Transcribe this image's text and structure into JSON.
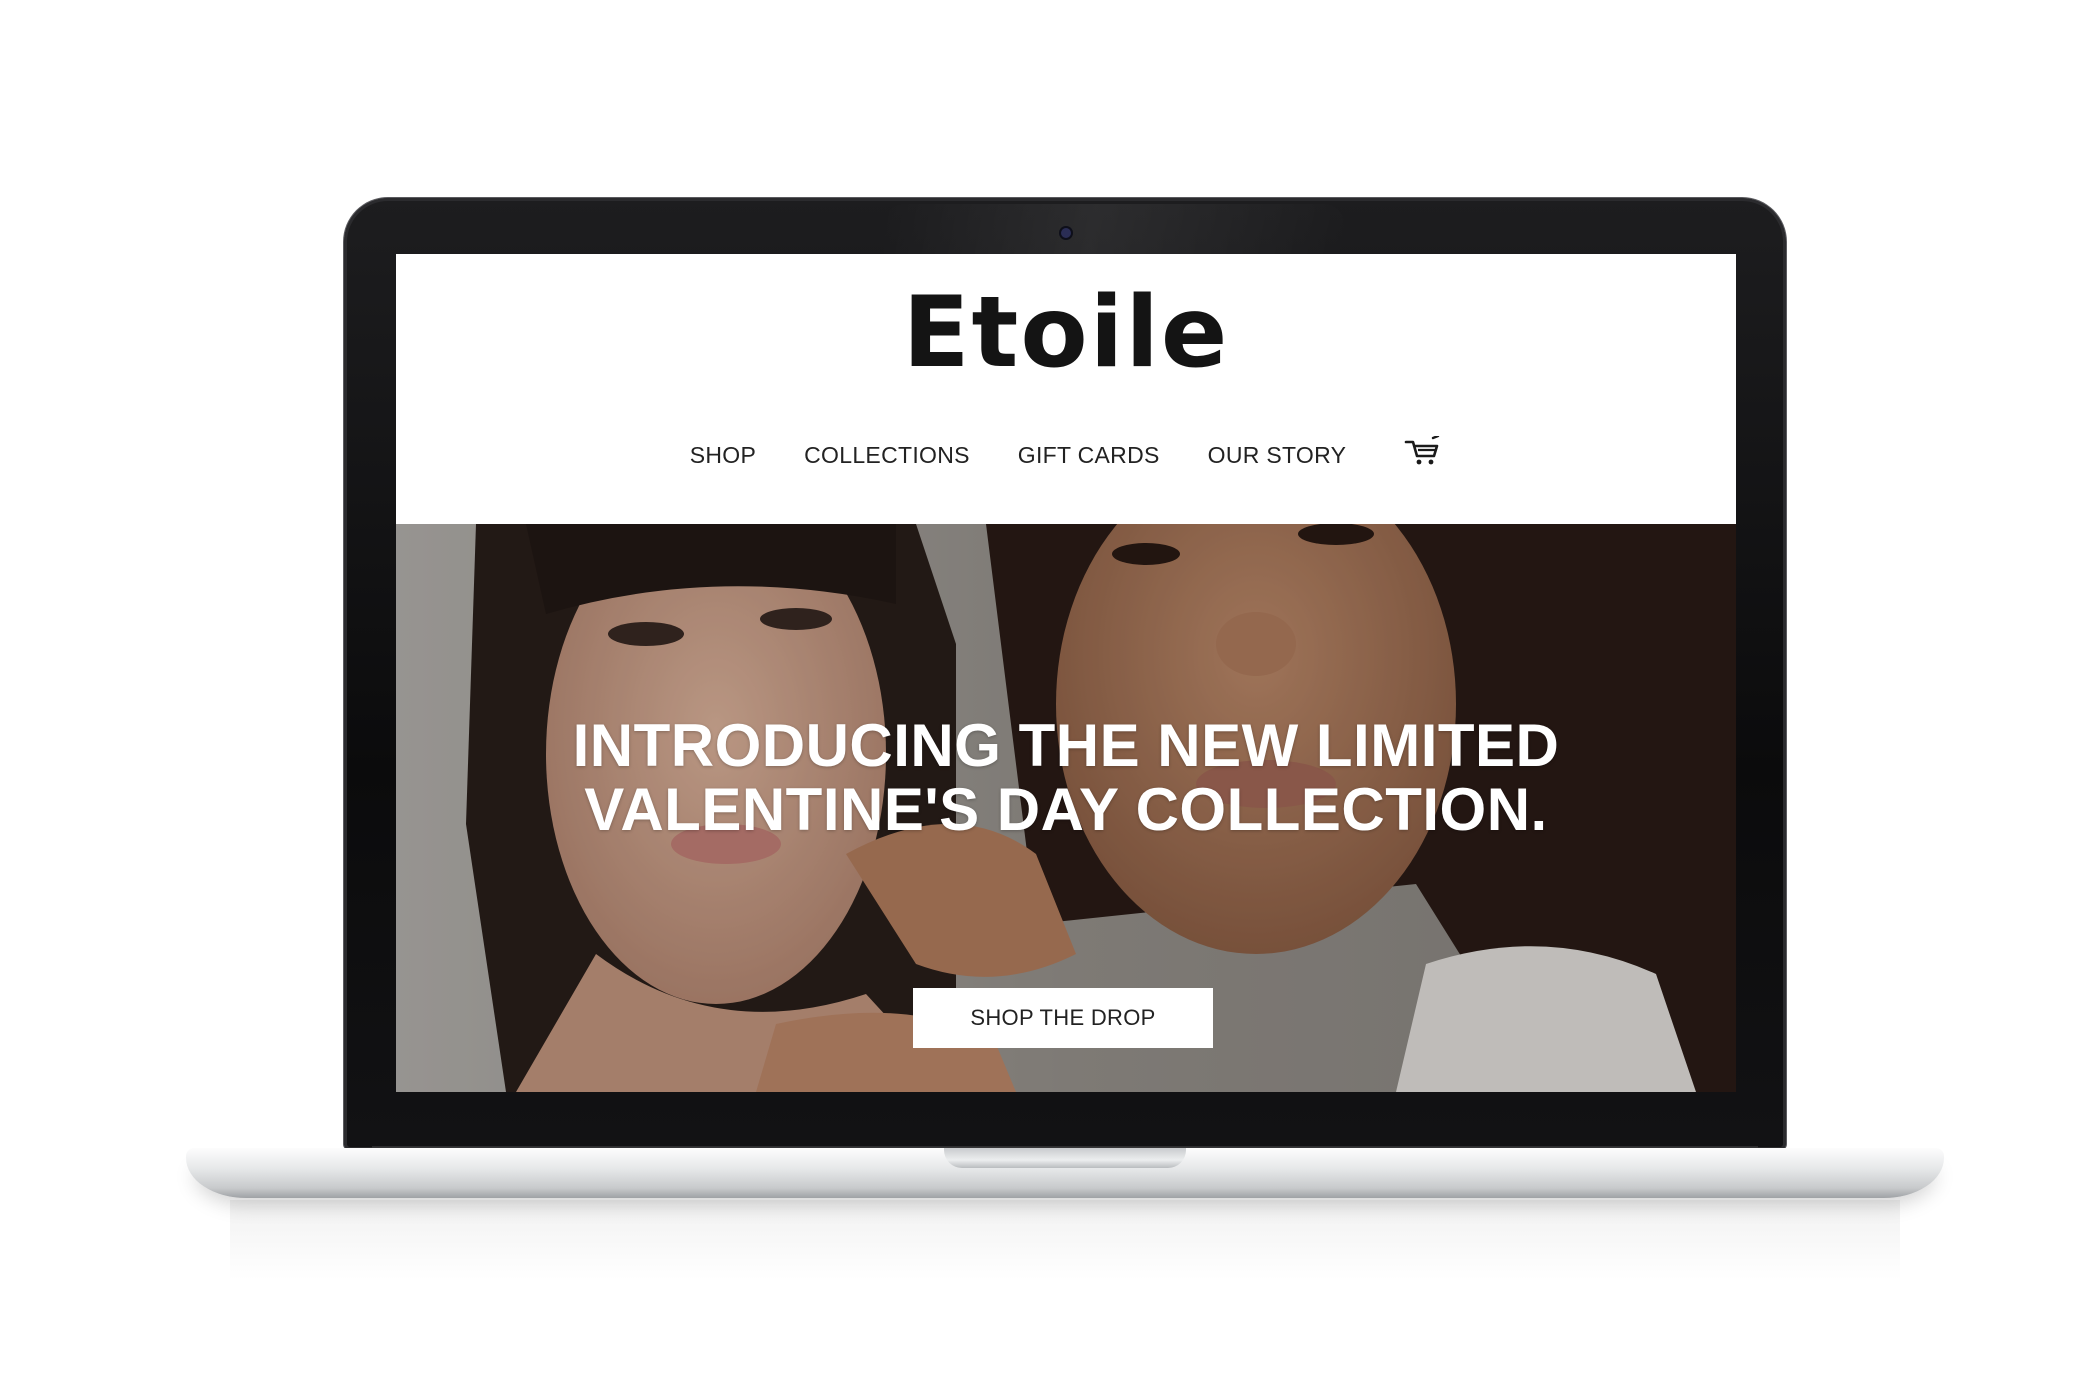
{
  "brand": {
    "name": "Etoile"
  },
  "nav": {
    "items": [
      {
        "label": "SHOP"
      },
      {
        "label": "COLLECTIONS"
      },
      {
        "label": "GIFT CARDS"
      },
      {
        "label": "OUR STORY"
      }
    ],
    "cart_icon": "shopping-cart-icon"
  },
  "hero": {
    "headline_line1": "INTRODUCING THE NEW LIMITED",
    "headline_line2": "VALENTINE'S DAY COLLECTION.",
    "cta_label": "SHOP THE DROP"
  },
  "colors": {
    "header_background": "#ffffff",
    "logo_text": "#141414",
    "nav_text": "#222222",
    "hero_text": "#ffffff",
    "cta_background": "#ffffff",
    "bezel": "#0b0b0c"
  }
}
